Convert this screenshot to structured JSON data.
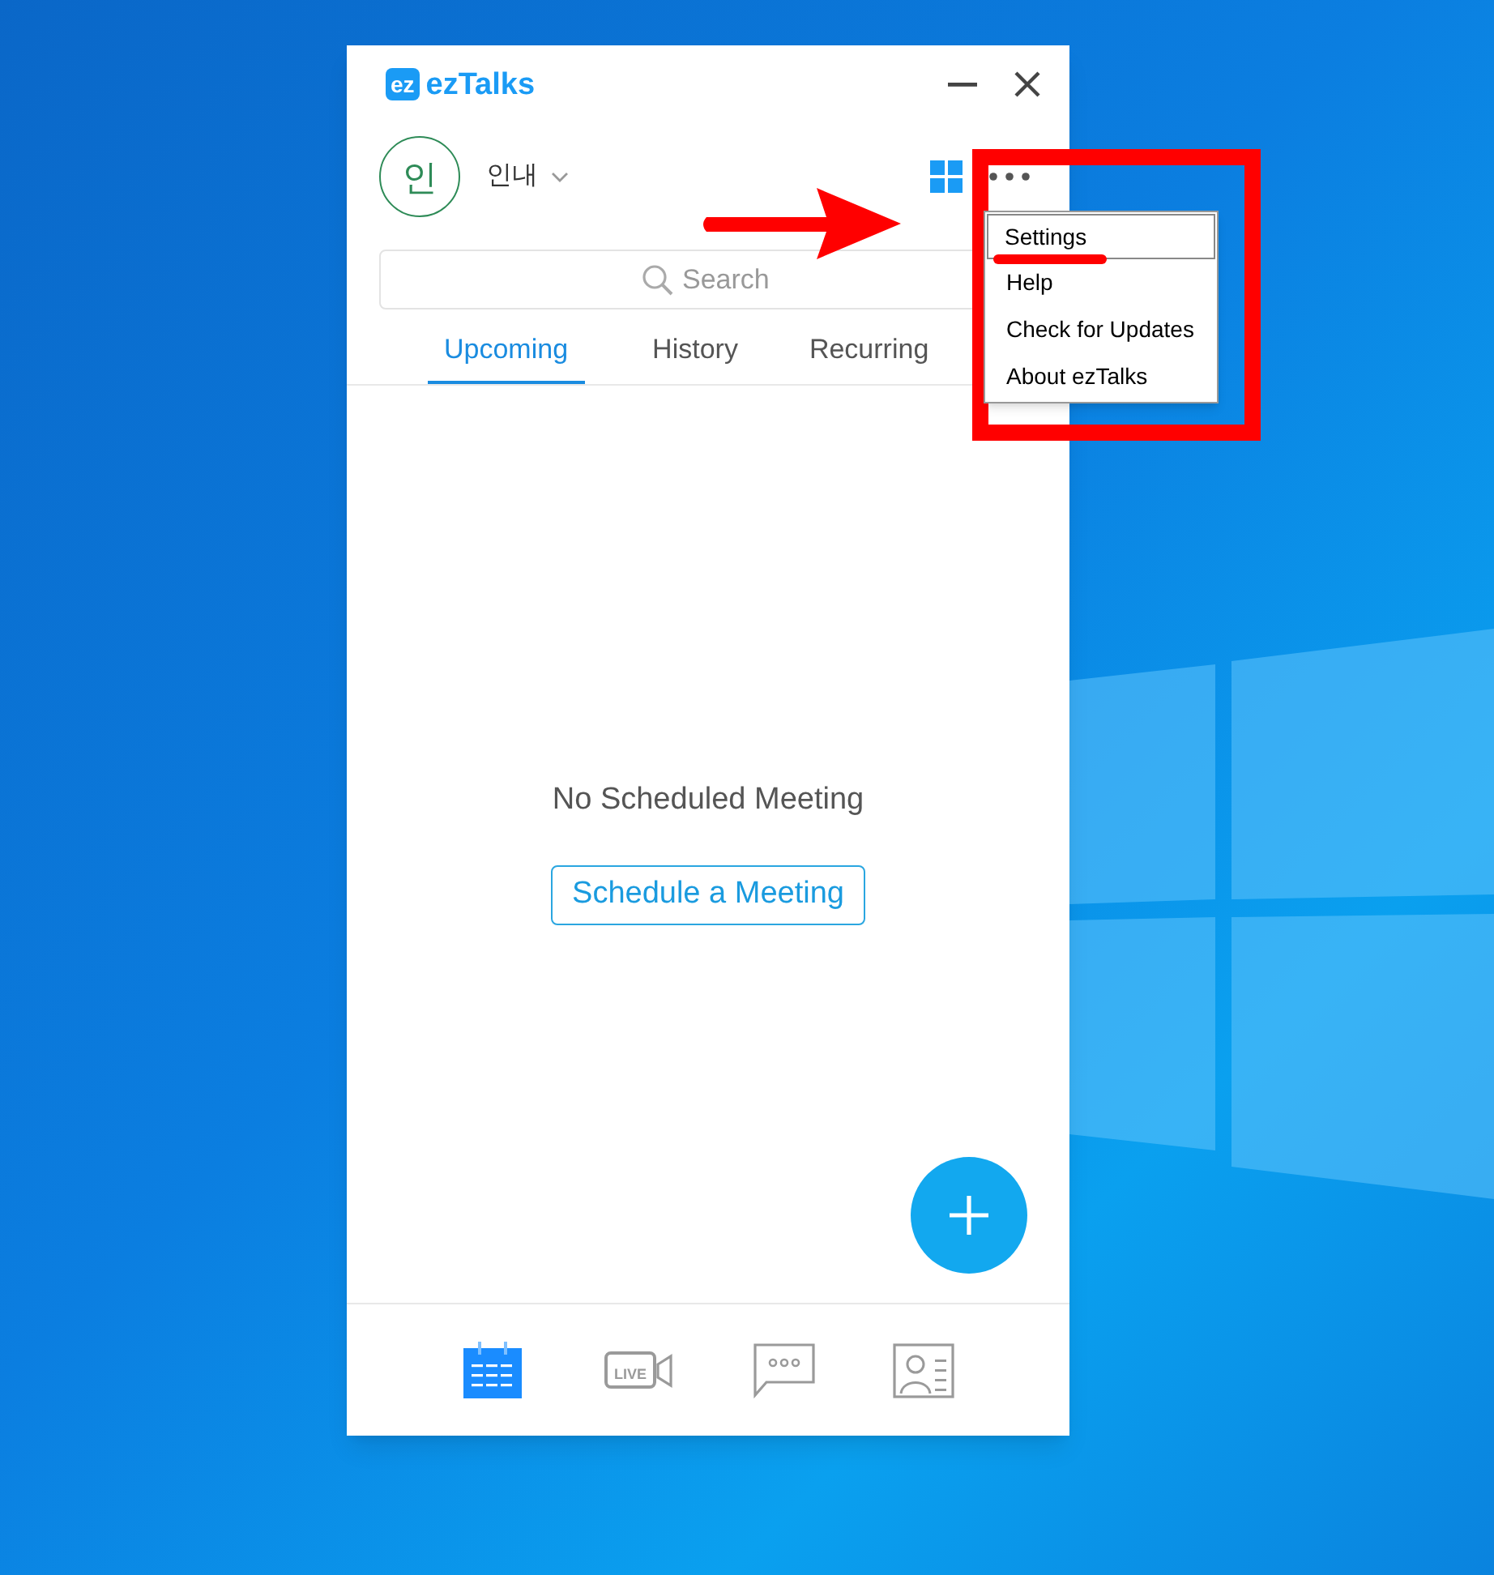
{
  "window": {
    "logo_text": "ez",
    "app_name": "ezTalks"
  },
  "user": {
    "avatar_initial": "인",
    "name": "인내"
  },
  "search": {
    "placeholder": "Search"
  },
  "tabs": [
    {
      "label": "Upcoming",
      "selected": true
    },
    {
      "label": "History",
      "selected": false
    },
    {
      "label": "Recurring",
      "selected": false
    }
  ],
  "empty_state": {
    "message": "No Scheduled Meeting",
    "button": "Schedule a Meeting"
  },
  "bottom_nav": [
    {
      "kind": "calendar",
      "selected": true
    },
    {
      "kind": "live",
      "label": "LIVE",
      "selected": false
    },
    {
      "kind": "chat",
      "selected": false
    },
    {
      "kind": "contacts",
      "selected": false
    }
  ],
  "menu": {
    "items": [
      {
        "label": "Settings",
        "selected": true
      },
      {
        "label": "Help",
        "selected": false
      },
      {
        "label": "Check for Updates",
        "selected": false
      },
      {
        "label": "About ezTalks",
        "selected": false
      }
    ]
  }
}
